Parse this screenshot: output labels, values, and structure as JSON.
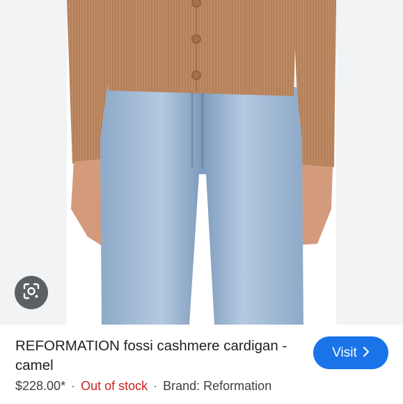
{
  "product": {
    "title": "REFORMATION fossi cashmere cardigan - camel",
    "price": "$228.00*",
    "stock_status": "Out of stock",
    "brand": "Brand: Reformation",
    "separator": "·"
  },
  "actions": {
    "visit_label": "Visit",
    "visit_icon": "chevron-right-icon",
    "lens_icon": "google-lens-icon"
  },
  "colors": {
    "accent": "#1a73e8",
    "out_of_stock": "#c5221f",
    "cardigan": "#b98662",
    "denim": "#9cb7d4"
  }
}
